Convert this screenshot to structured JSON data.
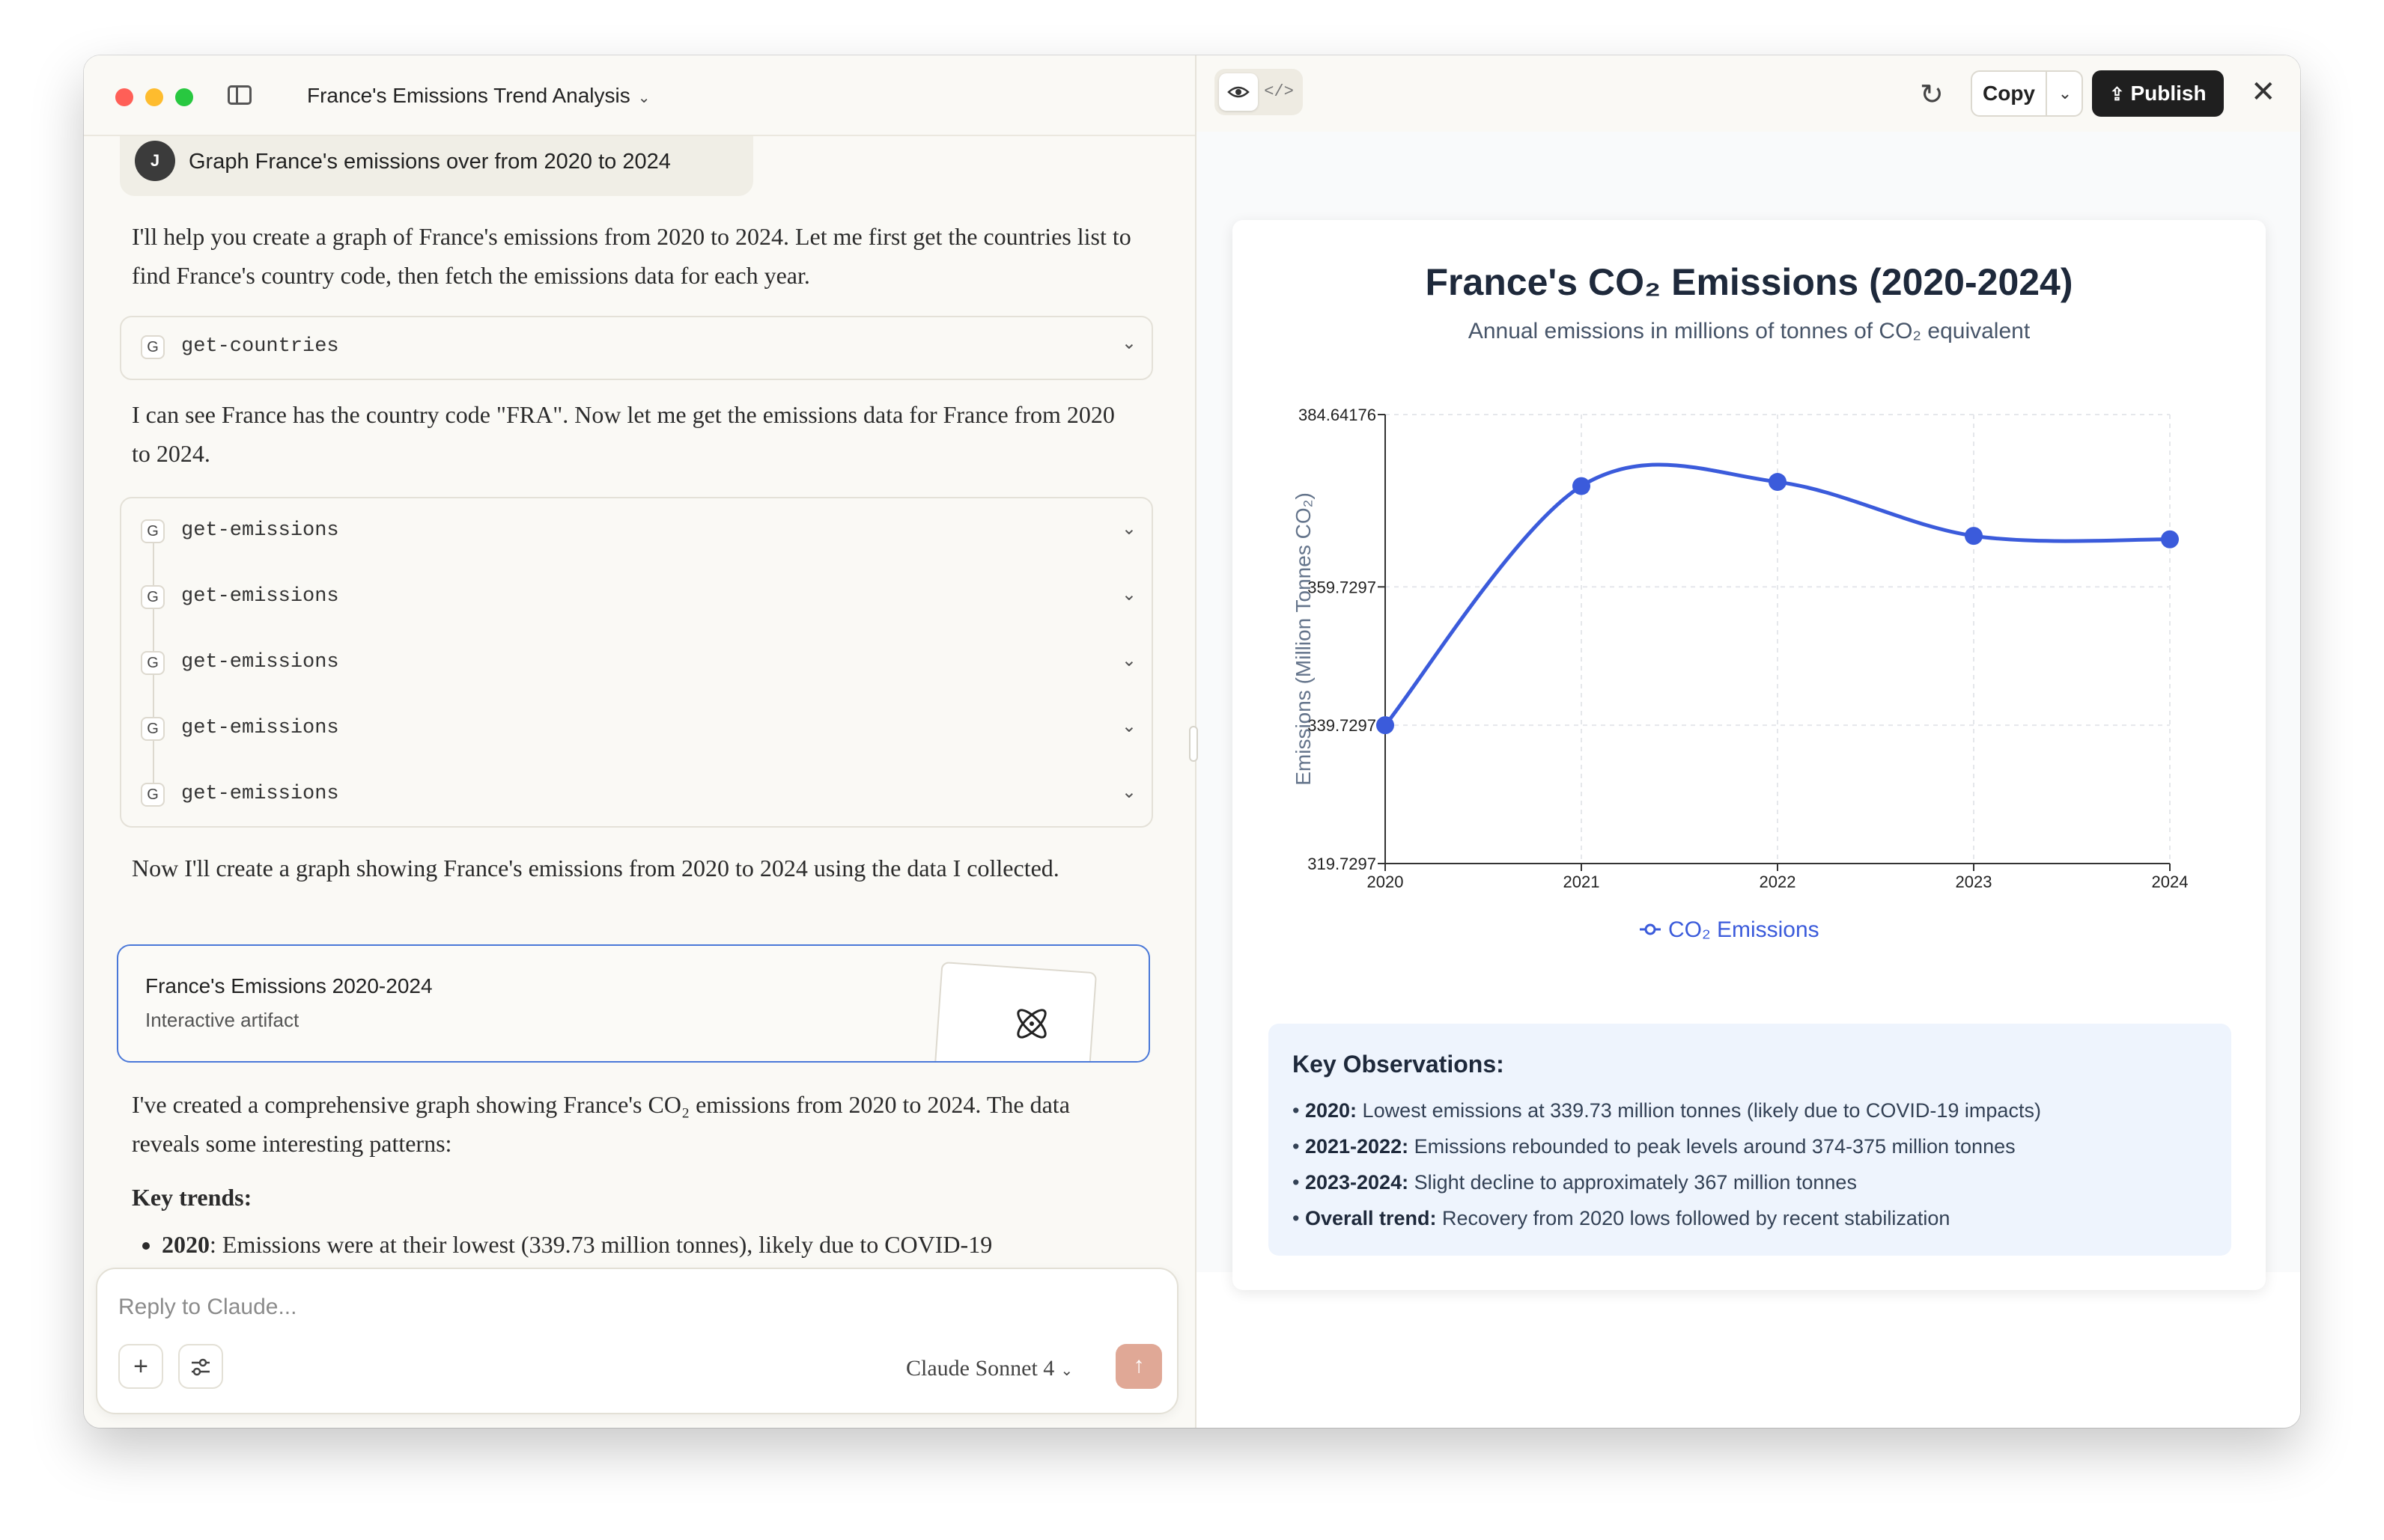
{
  "conversation": {
    "title": "France's Emissions Trend Analysis",
    "user_initial": "J",
    "user_message": "Graph France's emissions over from 2020 to 2024",
    "para1": "I'll help you create a graph of France's emissions from 2020 to 2024. Let me first get the countries list to find France's country code, then fetch the emissions data for each year.",
    "para2": "I can see France has the country code \"FRA\". Now let me get the emissions data for France from 2020 to 2024.",
    "para3": "Now I'll create a graph showing France's emissions from 2020 to 2024 using the data I collected.",
    "para4": "I've created a comprehensive graph showing France's CO₂ emissions from 2020 to 2024. The data reveals some interesting patterns:",
    "key_trends_heading": "Key trends:",
    "bullet_year": "2020",
    "bullet_text": ": Emissions were at their lowest (339.73 million tonnes), likely due to COVID-19",
    "tool_badge": "G",
    "tool_single": "get-countries",
    "tool_calls": [
      "get-emissions",
      "get-emissions",
      "get-emissions",
      "get-emissions",
      "get-emissions"
    ],
    "artifact": {
      "title": "France's Emissions 2020-2024",
      "subtitle": "Interactive artifact"
    }
  },
  "composer": {
    "placeholder": "Reply to Claude...",
    "model": "Claude Sonnet 4"
  },
  "artifact_toolbar": {
    "copy_label": "Copy",
    "publish_label": "Publish"
  },
  "chart_data": {
    "type": "line",
    "title": "France's CO₂ Emissions (2020-2024)",
    "subtitle": "Annual emissions in millions of tonnes of CO₂ equivalent",
    "ylabel": "Emissions (Million Tonnes CO₂)",
    "xlabel": "",
    "x": [
      "2020",
      "2021",
      "2022",
      "2023",
      "2024"
    ],
    "series": [
      {
        "name": "CO₂ Emissions",
        "color": "#3b5bdb",
        "values": [
          339.73,
          374.3,
          374.9,
          367.1,
          366.6
        ]
      }
    ],
    "ylim": [
      319.7297,
      384.64176
    ],
    "yticks": [
      "319.7297",
      "339.7297",
      "359.7297",
      "384.64176"
    ],
    "grid": true,
    "legend": "bottom-center",
    "line_color": "#3b5bdb"
  },
  "observations": {
    "title": "Key Observations:",
    "items": [
      {
        "label": "2020:",
        "text": "Lowest emissions at 339.73 million tonnes (likely due to COVID-19 impacts)"
      },
      {
        "label": "2021-2022:",
        "text": "Emissions rebounded to peak levels around 374-375 million tonnes"
      },
      {
        "label": "2023-2024:",
        "text": "Slight decline to approximately 367 million tonnes"
      },
      {
        "label": "Overall trend:",
        "text": "Recovery from 2020 lows followed by recent stabilization"
      }
    ]
  }
}
